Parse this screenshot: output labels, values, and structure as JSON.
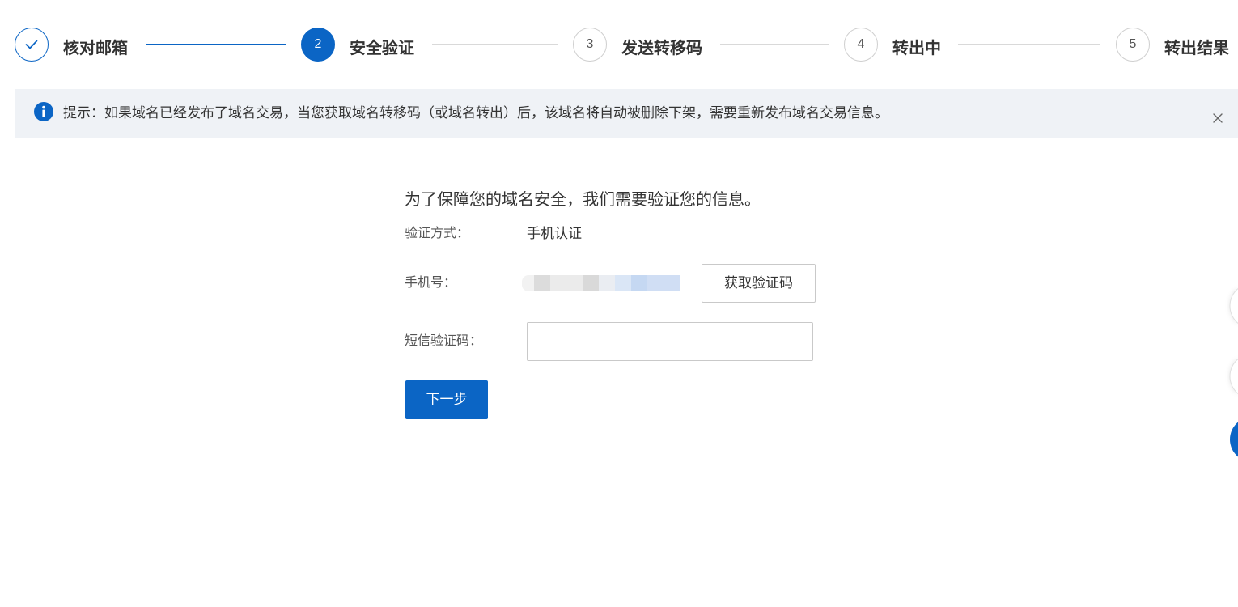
{
  "colors": {
    "primary": "#0b65c5",
    "pending_step_border": "#cfcfcf",
    "notice_background": "#eff2f6"
  },
  "stepper": {
    "steps": [
      {
        "icon": "check-icon",
        "label": "核对邮箱",
        "done": true,
        "current": false
      },
      {
        "number": "2",
        "label": "安全验证",
        "done": false,
        "current": true
      },
      {
        "number": "3",
        "label": "发送转移码",
        "done": false,
        "current": false
      },
      {
        "number": "4",
        "label": "转出中",
        "done": false,
        "current": false
      },
      {
        "number": "5",
        "label": "转出结果",
        "done": false,
        "current": false
      }
    ]
  },
  "notice": {
    "icon": "info-icon",
    "text": "提示：如果域名已经发布了域名交易，当您获取域名转移码（或域名转出）后，该域名将自动被删除下架，需要重新发布域名交易信息。",
    "close_icon": "close-icon"
  },
  "form": {
    "heading": "为了保障您的域名安全，我们需要验证您的信息。",
    "verify_method": {
      "label": "验证方式：",
      "value": "手机认证"
    },
    "phone": {
      "label": "手机号：",
      "value_masked": true
    },
    "get_code_button": {
      "label": "获取验证码"
    },
    "sms_code": {
      "label": "短信验证码：",
      "value": "",
      "placeholder": ""
    },
    "next_button": {
      "label": "下一步"
    }
  },
  "floating_buttons": [
    {
      "color": "#ffffff"
    },
    {
      "color": "#ffffff"
    },
    {
      "color": "#0b65c5"
    }
  ]
}
